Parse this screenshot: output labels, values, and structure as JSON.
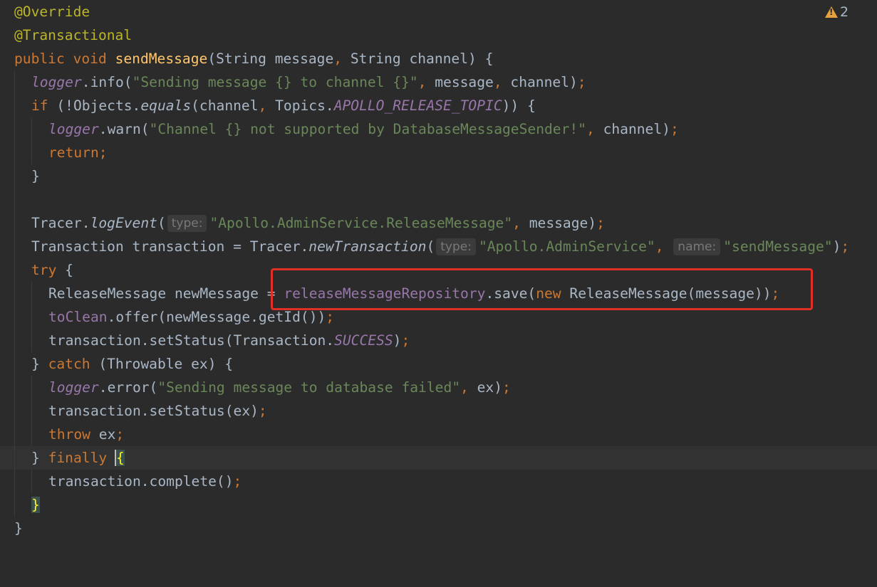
{
  "inspection": {
    "icon": "warning-triangle-icon",
    "count": "2"
  },
  "inlay_hints": {
    "type": "type:",
    "name": "name:"
  },
  "code": {
    "l1": {
      "a": "@Override"
    },
    "l2": {
      "a": "@Transactional"
    },
    "l3": {
      "a": "public",
      "b": " ",
      "c": "void",
      "d": " ",
      "e": "sendMessage",
      "f": "(String message",
      "g": ",",
      "h": " String channel) {"
    },
    "l4": {
      "a": "logger",
      "b": ".info(",
      "c": "\"Sending message {} to channel {}\"",
      "d": ",",
      "e": " message",
      "f": ",",
      "g": " channel)",
      "h": ";"
    },
    "l5": {
      "a": "if",
      "b": " (!Objects.",
      "c": "equals",
      "d": "(channel",
      "e": ",",
      "f": " Topics.",
      "g": "APOLLO_RELEASE_TOPIC",
      "h": ")) {"
    },
    "l6": {
      "a": "logger",
      "b": ".warn(",
      "c": "\"Channel {} not supported by DatabaseMessageSender!\"",
      "d": ",",
      "e": " channel)",
      "f": ";"
    },
    "l7": {
      "a": "return",
      "b": ";"
    },
    "l8": {
      "a": "}"
    },
    "l10": {
      "a": "Tracer.",
      "b": "logEvent",
      "c": "(",
      "d": "\"Apollo.AdminService.ReleaseMessage\"",
      "e": ",",
      "f": " message)",
      "g": ";"
    },
    "l11": {
      "a": "Transaction transaction = Tracer.",
      "b": "newTransaction",
      "c": "(",
      "d": "\"Apollo.AdminService\"",
      "e": ",",
      "f": " ",
      "g": "\"sendMessage\"",
      "h": ")",
      "i": ";"
    },
    "l12": {
      "a": "try",
      "b": " {"
    },
    "l13": {
      "a": "ReleaseMessage newMessage = ",
      "b": "releaseMessageRepository",
      "c": ".save(",
      "d": "new",
      "e": " ReleaseMessage(message))",
      "f": ";"
    },
    "l14": {
      "a": "toClean",
      "b": ".offer(newMessage.getId())",
      "c": ";"
    },
    "l15": {
      "a": "transaction.setStatus(Transaction.",
      "b": "SUCCESS",
      "c": ")",
      "d": ";"
    },
    "l16": {
      "a": "} ",
      "b": "catch",
      "c": " (Throwable ex) {"
    },
    "l17": {
      "a": "logger",
      "b": ".error(",
      "c": "\"Sending message to database failed\"",
      "d": ",",
      "e": " ex)",
      "f": ";"
    },
    "l18": {
      "a": "transaction.setStatus(ex)",
      "b": ";"
    },
    "l19": {
      "a": "throw",
      "b": " ex",
      "c": ";"
    },
    "l20": {
      "a": "} ",
      "b": "finally",
      "c": " ",
      "d": "{"
    },
    "l21": {
      "a": "transaction.complete()",
      "b": ";"
    },
    "l22": {
      "a": "}"
    },
    "l23": {
      "a": "}"
    }
  }
}
